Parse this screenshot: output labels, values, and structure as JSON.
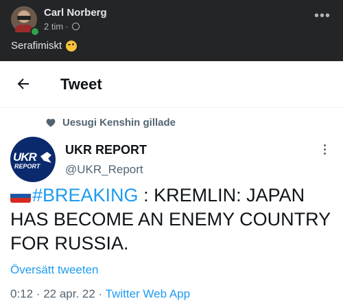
{
  "facebook_post": {
    "author": "Carl Norberg",
    "time": "2 tim",
    "separator": "·",
    "text": "Serafimiskt",
    "more_icon": "more-horizontal-icon",
    "privacy_icon": "globe-icon"
  },
  "twitter": {
    "header_title": "Tweet",
    "liked_by": "Uesugi Kenshin gillade",
    "author_name": "UKR REPORT",
    "author_handle": "@UKR_Report",
    "avatar_line1": "UKR",
    "avatar_line2": "REPORT",
    "hashtag": "#BREAKING",
    "body": " : KREMLIN: JAPAN HAS BECOME AN ENEMY COUNTRY FOR RUSSIA.",
    "translate_link": "Översätt tweeten",
    "timestamp_partial": "0:12 · 22 apr. 22 · ",
    "app_partial": "Twitter Web App",
    "colors": {
      "link": "#1d9bf0",
      "text": "#0f1419",
      "muted": "#536471"
    }
  }
}
